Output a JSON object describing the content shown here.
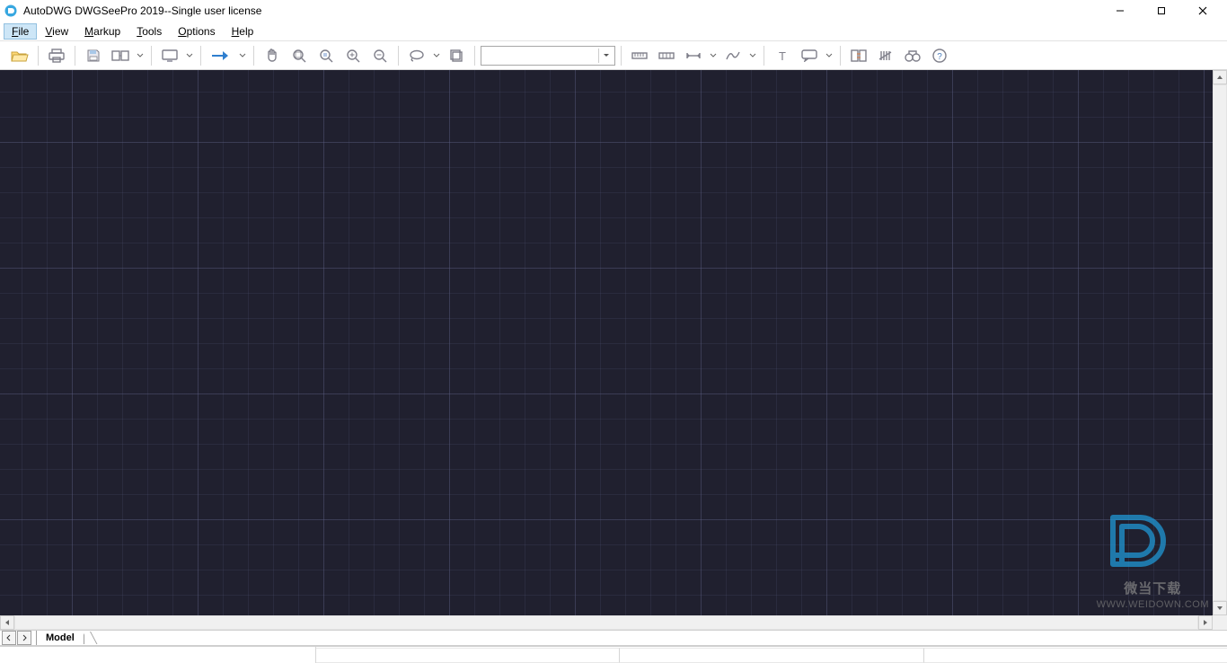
{
  "titlebar": {
    "title": "AutoDWG DWGSeePro 2019--Single user license"
  },
  "menubar": {
    "items": [
      {
        "label": "File",
        "underline_index": 0,
        "active": true
      },
      {
        "label": "View",
        "underline_index": 0
      },
      {
        "label": "Markup",
        "underline_index": 0
      },
      {
        "label": "Tools",
        "underline_index": 0
      },
      {
        "label": "Options",
        "underline_index": 0
      },
      {
        "label": "Help",
        "underline_index": 0
      }
    ]
  },
  "toolbar": {
    "combo_value": ""
  },
  "tabs": {
    "active": "Model"
  },
  "watermark": {
    "cn": "微当下载",
    "url": "WWW.WEIDOWN.COM"
  }
}
